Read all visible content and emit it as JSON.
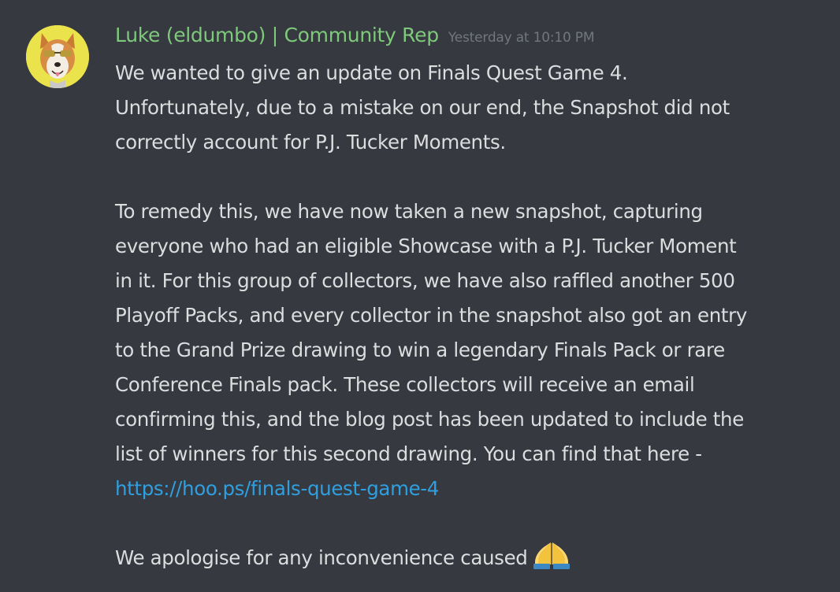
{
  "author": {
    "username": "Luke (eldumbo) | Community Rep",
    "timestamp": "Yesterday at 10:10 PM",
    "avatar_icon": "dog-avatar-icon",
    "name_color": "#7ec97b"
  },
  "message": {
    "paragraph1": [
      "We wanted to give an update on Finals Quest Game 4.",
      "Unfortunately, due to a mistake on our end, the Snapshot did not",
      "correctly account for P.J. Tucker Moments."
    ],
    "paragraph2": [
      "To remedy this, we have now taken a new snapshot, capturing",
      "everyone who had an eligible Showcase with a P.J. Tucker Moment",
      "in it. For this group of collectors, we have also raffled another 500",
      "Playoff Packs, and every collector in the snapshot also got an entry",
      "to the Grand Prize drawing to win a legendary Finals Pack or rare",
      "Conference Finals pack. These collectors will receive an email",
      "confirming this, and the blog post has been updated to include the",
      "list of winners for this second drawing. You can find that here -"
    ],
    "link": "https://hoo.ps/finals-quest-game-4",
    "closing": "We apologise for any inconvenience caused",
    "closing_emoji": "folded-hands-emoji",
    "link_color": "#2f9fe0"
  }
}
